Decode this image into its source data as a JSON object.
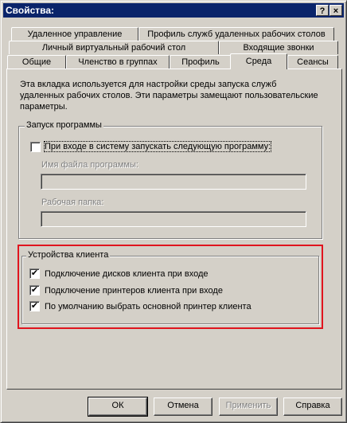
{
  "window": {
    "title": "Свойства:",
    "help_glyph": "?",
    "close_glyph": "×"
  },
  "tabs": {
    "row1": [
      "Удаленное управление",
      "Профиль служб удаленных рабочих столов"
    ],
    "row2": [
      "Личный виртуальный рабочий стол",
      "Входящие звонки"
    ],
    "row3": [
      "Общие",
      "Членство в группах",
      "Профиль",
      "Среда",
      "Сеансы"
    ],
    "active": "Среда"
  },
  "description": "Эта вкладка используется для настройки среды запуска служб удаленных рабочих столов. Эти параметры замещают пользовательские параметры.",
  "program_group": {
    "legend": "Запуск программы",
    "start_checkbox": {
      "label": "При входе в систему запускать следующую программу:",
      "checked": false
    },
    "filename_label": "Имя файла программы:",
    "filename_value": "",
    "folder_label": "Рабочая папка:",
    "folder_value": ""
  },
  "client_devices": {
    "legend": "Устройства клиента",
    "items": [
      {
        "label": "Подключение дисков клиента при входе",
        "checked": true,
        "mark": "✔"
      },
      {
        "label": "Подключение принтеров клиента при входе",
        "checked": true,
        "mark": "✔"
      },
      {
        "label": "По умолчанию выбрать основной принтер клиента",
        "checked": true,
        "mark": "✔"
      }
    ],
    "highlight_color": "#e0141e"
  },
  "buttons": {
    "ok": "ОК",
    "cancel": "Отмена",
    "apply": "Применить",
    "help": "Справка"
  }
}
